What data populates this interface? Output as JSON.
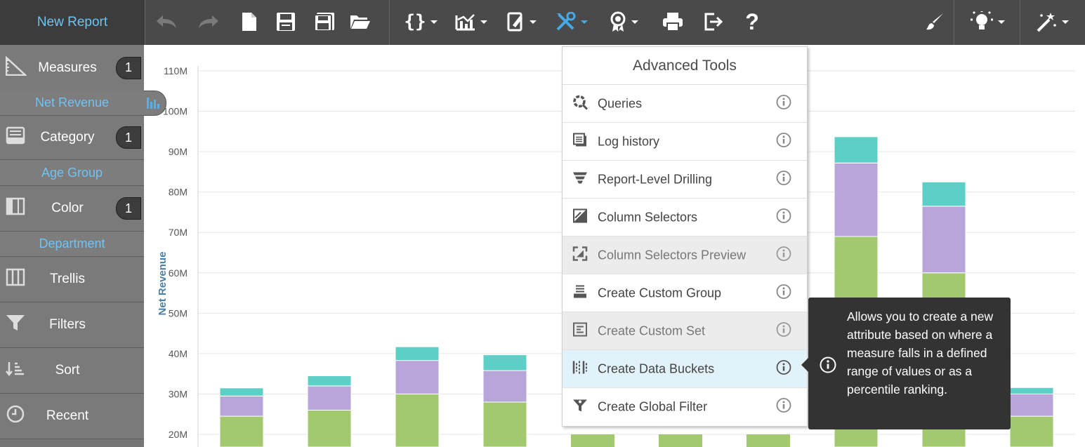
{
  "header": {
    "report_title": "New Report"
  },
  "left_panel": {
    "measures": {
      "label": "Measures",
      "count": "1",
      "field": "Net Revenue"
    },
    "category": {
      "label": "Category",
      "count": "1",
      "field": "Age Group"
    },
    "color": {
      "label": "Color",
      "count": "1",
      "field": "Department"
    },
    "trellis": {
      "label": "Trellis"
    },
    "filters": {
      "label": "Filters"
    },
    "sort": {
      "label": "Sort"
    },
    "recent": {
      "label": "Recent"
    }
  },
  "dropdown": {
    "title": "Advanced Tools",
    "items": [
      {
        "label": "Queries",
        "icon": "queries-icon",
        "state": "normal"
      },
      {
        "label": "Log history",
        "icon": "log-history-icon",
        "state": "normal"
      },
      {
        "label": "Report-Level Drilling",
        "icon": "drilling-icon",
        "state": "normal"
      },
      {
        "label": "Column Selectors",
        "icon": "column-selectors-icon",
        "state": "normal"
      },
      {
        "label": "Column Selectors Preview",
        "icon": "column-selectors-preview-icon",
        "state": "disabled"
      },
      {
        "label": "Create Custom Group",
        "icon": "custom-group-icon",
        "state": "normal"
      },
      {
        "label": "Create Custom Set",
        "icon": "custom-set-icon",
        "state": "disabled"
      },
      {
        "label": "Create Data Buckets",
        "icon": "data-buckets-icon",
        "state": "hovered"
      },
      {
        "label": "Create Global Filter",
        "icon": "global-filter-icon",
        "state": "normal"
      }
    ]
  },
  "tooltip": {
    "text": "Allows you to create a new attribute based on where a measure falls in a defined range of values or as a percentile ranking."
  },
  "colors": {
    "green": "#a3c96e",
    "purple": "#b8a5d9",
    "teal": "#5ccfc6",
    "accent": "#46a9e6",
    "axis_title": "#4a7fa8"
  },
  "chart_data": {
    "type": "bar",
    "stacked": true,
    "ylabel": "Net Revenue",
    "yticks": [
      "110M",
      "100M",
      "90M",
      "80M",
      "70M",
      "60M",
      "50M",
      "40M",
      "30M",
      "20M"
    ],
    "ylim": [
      20,
      110
    ],
    "categories": [
      "",
      "",
      "",
      "",
      "",
      "",
      "",
      "",
      "",
      ""
    ],
    "series": [
      {
        "color": "#a3c96e",
        "values": [
          24.5,
          26,
          30,
          28,
          null,
          null,
          null,
          69,
          60,
          24.5
        ]
      },
      {
        "color": "#b8a5d9",
        "values": [
          5,
          6,
          8.3,
          7.8,
          null,
          null,
          null,
          18.2,
          16.5,
          5.5
        ]
      },
      {
        "color": "#5ccfc6",
        "values": [
          2,
          2.5,
          3.4,
          3.9,
          null,
          null,
          null,
          6.5,
          6,
          1.6
        ]
      }
    ],
    "grid": true
  }
}
